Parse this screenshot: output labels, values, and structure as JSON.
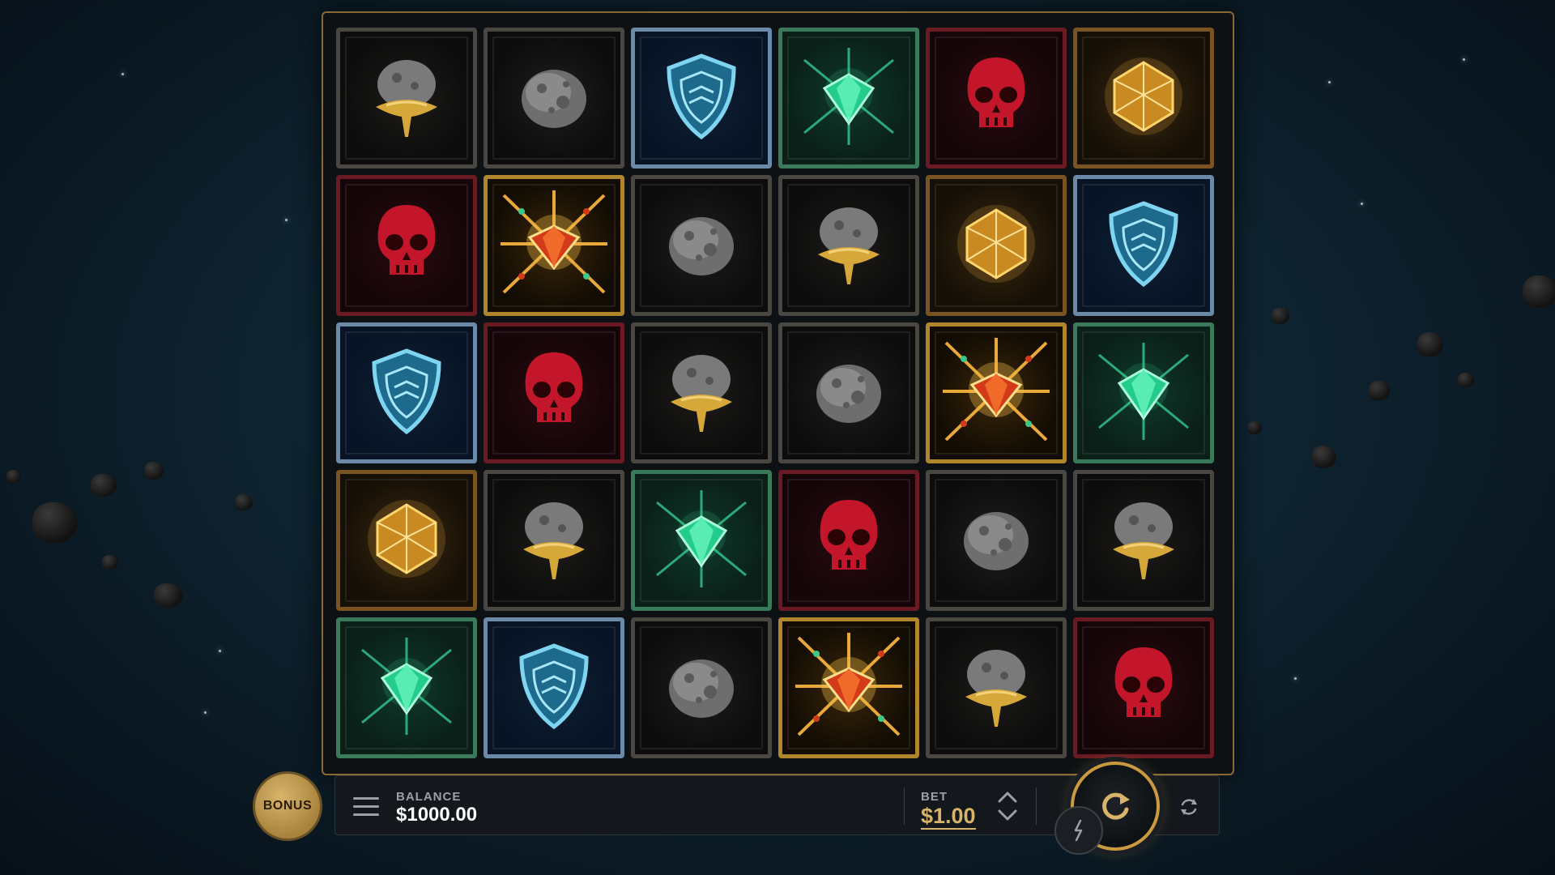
{
  "game": {
    "grid": [
      [
        "rock-gold",
        "rock",
        "shield",
        "emerald",
        "skull",
        "dice"
      ],
      [
        "skull",
        "ruby",
        "rock",
        "rock-gold",
        "dice",
        "shield"
      ],
      [
        "shield",
        "skull",
        "rock-gold",
        "rock",
        "ruby",
        "emerald"
      ],
      [
        "dice",
        "rock-gold",
        "emerald",
        "skull",
        "rock",
        "rock-gold"
      ],
      [
        "emerald",
        "shield",
        "rock",
        "ruby",
        "rock-gold",
        "skull"
      ]
    ]
  },
  "controls": {
    "bonus_label": "BONUS",
    "balance_label": "BALANCE",
    "balance_value": "$1000.00",
    "bet_label": "BET",
    "bet_value": "$1.00"
  },
  "colors": {
    "accent_gold": "#d8b46a",
    "board_border": "#8a6a34"
  },
  "icons": {
    "menu": "hamburger-menu-icon",
    "bet_adjust": "chevron-up-down-icon",
    "spin": "spin-refresh-icon",
    "turbo": "lightning-icon",
    "autoplay": "autoplay-icon"
  }
}
